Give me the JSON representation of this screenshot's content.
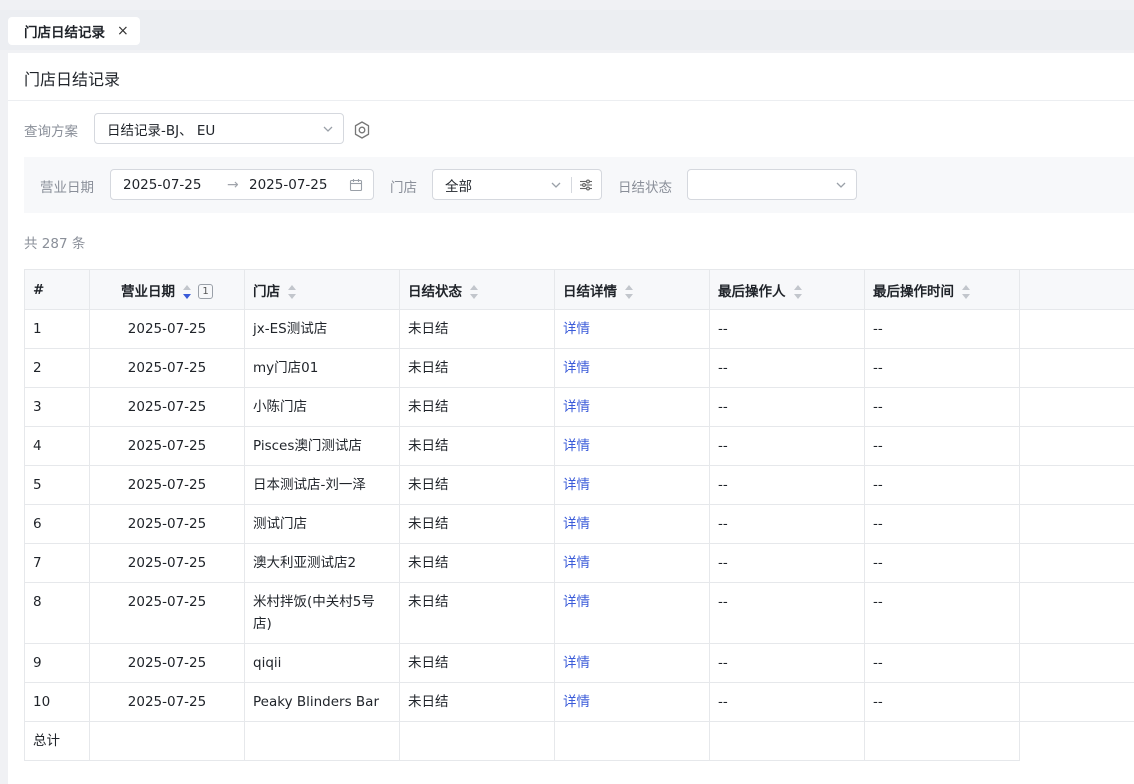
{
  "tab": {
    "label": "门店日结记录",
    "close": "×"
  },
  "page": {
    "title": "门店日结记录"
  },
  "query": {
    "label": "查询方案",
    "value": "日结记录-BJ、 EU"
  },
  "filters": {
    "date_label": "营业日期",
    "date_start": "2025-07-25",
    "date_end": "2025-07-25",
    "date_separator": "→",
    "store_label": "门店",
    "store_value": "全部",
    "status_label": "日结状态",
    "status_value": ""
  },
  "summary": {
    "count_text": "共 287 条"
  },
  "table": {
    "columns": {
      "index": "#",
      "date": "营业日期",
      "date_sort_order": "1",
      "store": "门店",
      "status": "日结状态",
      "detail": "日结详情",
      "operator": "最后操作人",
      "time": "最后操作时间"
    },
    "rows": [
      {
        "idx": "1",
        "date": "2025-07-25",
        "store": "jx-ES测试店",
        "status": "未日结",
        "detail": "详情",
        "operator": "--",
        "time": "--"
      },
      {
        "idx": "2",
        "date": "2025-07-25",
        "store": "my门店01",
        "status": "未日结",
        "detail": "详情",
        "operator": "--",
        "time": "--"
      },
      {
        "idx": "3",
        "date": "2025-07-25",
        "store": "小陈门店",
        "status": "未日结",
        "detail": "详情",
        "operator": "--",
        "time": "--"
      },
      {
        "idx": "4",
        "date": "2025-07-25",
        "store": "Pisces澳门测试店",
        "status": "未日结",
        "detail": "详情",
        "operator": "--",
        "time": "--"
      },
      {
        "idx": "5",
        "date": "2025-07-25",
        "store": "日本测试店-刘一泽",
        "status": "未日结",
        "detail": "详情",
        "operator": "--",
        "time": "--"
      },
      {
        "idx": "6",
        "date": "2025-07-25",
        "store": "测试门店",
        "status": "未日结",
        "detail": "详情",
        "operator": "--",
        "time": "--"
      },
      {
        "idx": "7",
        "date": "2025-07-25",
        "store": "澳大利亚测试店2",
        "status": "未日结",
        "detail": "详情",
        "operator": "--",
        "time": "--"
      },
      {
        "idx": "8",
        "date": "2025-07-25",
        "store": "米村拌饭(中关村5号店)",
        "status": "未日结",
        "detail": "详情",
        "operator": "--",
        "time": "--"
      },
      {
        "idx": "9",
        "date": "2025-07-25",
        "store": "qiqii",
        "status": "未日结",
        "detail": "详情",
        "operator": "--",
        "time": "--"
      },
      {
        "idx": "10",
        "date": "2025-07-25",
        "store": "Peaky Blinders Bar",
        "status": "未日结",
        "detail": "详情",
        "operator": "--",
        "time": "--"
      }
    ],
    "total_label": "总计"
  },
  "colors": {
    "accent": "#3a5bd9",
    "border": "#e6e8eb",
    "header_bg": "#f7f8fa",
    "label": "#8a8f99"
  }
}
